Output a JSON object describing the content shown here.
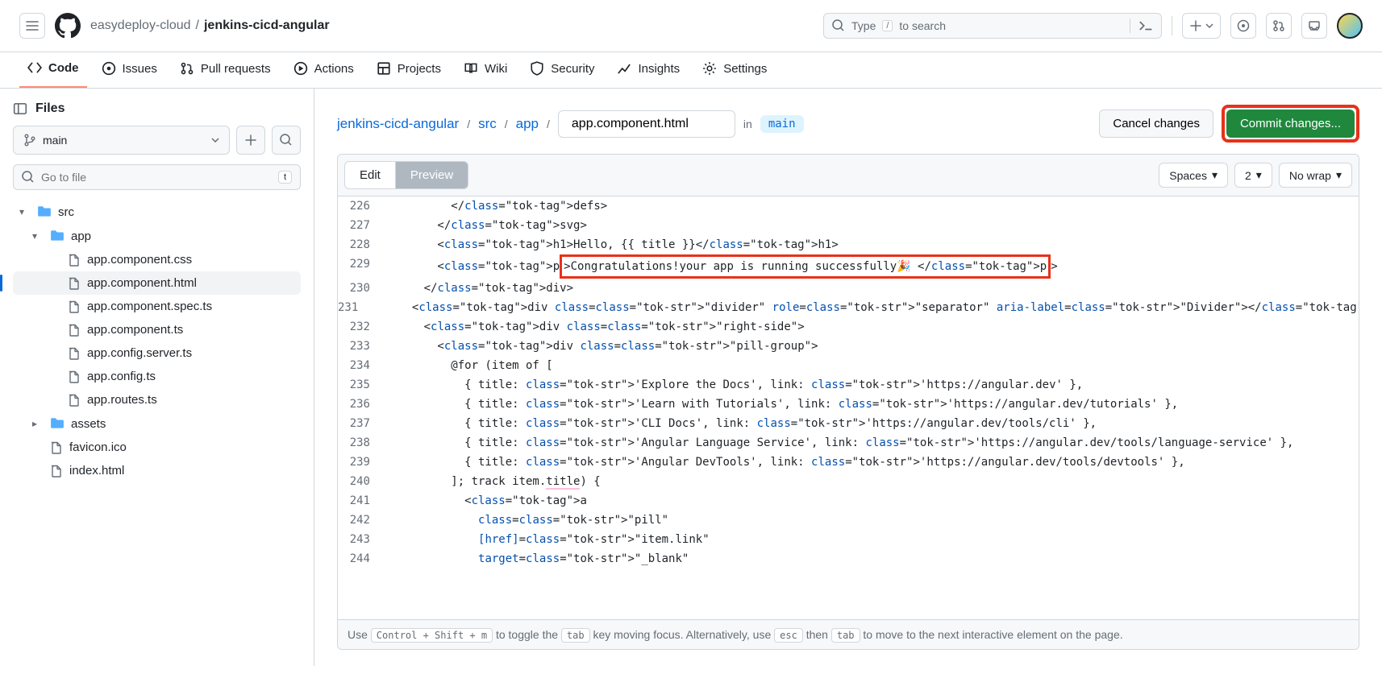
{
  "header": {
    "owner": "easydeploy-cloud",
    "repo": "jenkins-cicd-angular",
    "search_placeholder": "Type",
    "search_suffix": "to search",
    "search_key": "/"
  },
  "nav": [
    {
      "icon": "code",
      "label": "Code"
    },
    {
      "icon": "issues",
      "label": "Issues"
    },
    {
      "icon": "pr",
      "label": "Pull requests"
    },
    {
      "icon": "actions",
      "label": "Actions"
    },
    {
      "icon": "projects",
      "label": "Projects"
    },
    {
      "icon": "wiki",
      "label": "Wiki"
    },
    {
      "icon": "security",
      "label": "Security"
    },
    {
      "icon": "insights",
      "label": "Insights"
    },
    {
      "icon": "settings",
      "label": "Settings"
    }
  ],
  "sidebar": {
    "title": "Files",
    "branch": "main",
    "go_to_file": "Go to file",
    "go_to_file_key": "t",
    "tree": [
      {
        "type": "folder",
        "name": "src",
        "level": 0,
        "open": true
      },
      {
        "type": "folder",
        "name": "app",
        "level": 1,
        "open": true
      },
      {
        "type": "file",
        "name": "app.component.css",
        "level": 2
      },
      {
        "type": "file",
        "name": "app.component.html",
        "level": 2,
        "active": true
      },
      {
        "type": "file",
        "name": "app.component.spec.ts",
        "level": 2
      },
      {
        "type": "file",
        "name": "app.component.ts",
        "level": 2
      },
      {
        "type": "file",
        "name": "app.config.server.ts",
        "level": 2
      },
      {
        "type": "file",
        "name": "app.config.ts",
        "level": 2
      },
      {
        "type": "file",
        "name": "app.routes.ts",
        "level": 2
      },
      {
        "type": "folder",
        "name": "assets",
        "level": 1,
        "open": false
      },
      {
        "type": "file",
        "name": "favicon.ico",
        "level": 1
      },
      {
        "type": "file",
        "name": "index.html",
        "level": 1
      }
    ]
  },
  "content": {
    "path": [
      "jenkins-cicd-angular",
      "src",
      "app"
    ],
    "filename": "app.component.html",
    "in_label": "in",
    "branch": "main",
    "cancel_label": "Cancel changes",
    "commit_label": "Commit changes...",
    "tabs": {
      "edit": "Edit",
      "preview": "Preview"
    },
    "selectors": {
      "indent": "Spaces",
      "size": "2",
      "wrap": "No wrap"
    },
    "lines": [
      {
        "n": 226,
        "text": "          </defs>"
      },
      {
        "n": 227,
        "text": "        </svg>"
      },
      {
        "n": 228,
        "text": "        <h1>Hello, {{ title }}</h1>"
      },
      {
        "n": 229,
        "text": "        <p>Congratulations!your app is running successfully🎉 </p>",
        "highlight": true
      },
      {
        "n": 230,
        "text": "      </div>"
      },
      {
        "n": 231,
        "text": "      <div class=\"divider\" role=\"separator\" aria-label=\"Divider\"></div>"
      },
      {
        "n": 232,
        "text": "      <div class=\"right-side\">"
      },
      {
        "n": 233,
        "text": "        <div class=\"pill-group\">"
      },
      {
        "n": 234,
        "text": "          @for (item of ["
      },
      {
        "n": 235,
        "text": "            { title: 'Explore the Docs', link: 'https://angular.dev' },"
      },
      {
        "n": 236,
        "text": "            { title: 'Learn with Tutorials', link: 'https://angular.dev/tutorials' },"
      },
      {
        "n": 237,
        "text": "            { title: 'CLI Docs', link: 'https://angular.dev/tools/cli' },"
      },
      {
        "n": 238,
        "text": "            { title: 'Angular Language Service', link: 'https://angular.dev/tools/language-service' },"
      },
      {
        "n": 239,
        "text": "            { title: 'Angular DevTools', link: 'https://angular.dev/tools/devtools' },"
      },
      {
        "n": 240,
        "text": "          ]; track item.title) {"
      },
      {
        "n": 241,
        "text": "            <a"
      },
      {
        "n": 242,
        "text": "              class=\"pill\""
      },
      {
        "n": 243,
        "text": "              [href]=\"item.link\""
      },
      {
        "n": 244,
        "text": "              target=\"_blank\""
      }
    ],
    "footer": {
      "p1": "Use",
      "k1": "Control + Shift + m",
      "p2": "to toggle the",
      "k2": "tab",
      "p3": "key moving focus. Alternatively, use",
      "k3": "esc",
      "p4": "then",
      "k4": "tab",
      "p5": "to move to the next interactive element on the page."
    }
  }
}
